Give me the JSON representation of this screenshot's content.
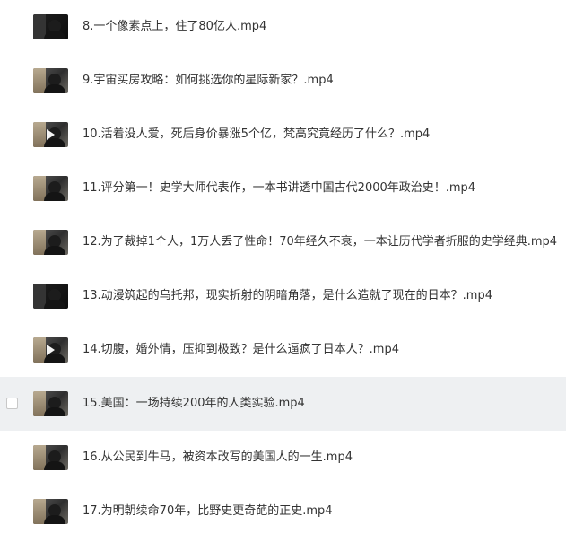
{
  "files": [
    {
      "name": "8.一个像素点上，住了80亿人.mp4",
      "thumb_icon": "video-thumbnail"
    },
    {
      "name": "9.宇宙买房攻略：如何挑选你的星际新家？.mp4",
      "thumb_icon": "video-thumbnail"
    },
    {
      "name": "10.活着没人爱，死后身价暴涨5个亿，梵高究竟经历了什么？.mp4",
      "thumb_icon": "video-thumbnail-play"
    },
    {
      "name": "11.评分第一！史学大师代表作，一本书讲透中国古代2000年政治史！.mp4",
      "thumb_icon": "video-thumbnail"
    },
    {
      "name": "12.为了裁掉1个人，1万人丢了性命！70年经久不衰，一本让历代学者折服的史学经典.mp4",
      "thumb_icon": "video-thumbnail"
    },
    {
      "name": "13.动漫筑起的乌托邦，现实折射的阴暗角落，是什么造就了现在的日本？.mp4",
      "thumb_icon": "video-thumbnail"
    },
    {
      "name": "14.切腹，婚外情，压抑到极致？是什么逼疯了日本人？.mp4",
      "thumb_icon": "video-thumbnail-play"
    },
    {
      "name": "15.美国：一场持续200年的人类实验.mp4",
      "thumb_icon": "video-thumbnail"
    },
    {
      "name": "16.从公民到牛马，被资本改写的美国人的一生.mp4",
      "thumb_icon": "video-thumbnail"
    },
    {
      "name": "17.为明朝续命70年，比野史更奇葩的正史.mp4",
      "thumb_icon": "video-thumbnail"
    }
  ],
  "colors": {
    "hover_row": "#eef0f2",
    "text": "#333333",
    "checkbox_border": "#c8c8c8"
  }
}
